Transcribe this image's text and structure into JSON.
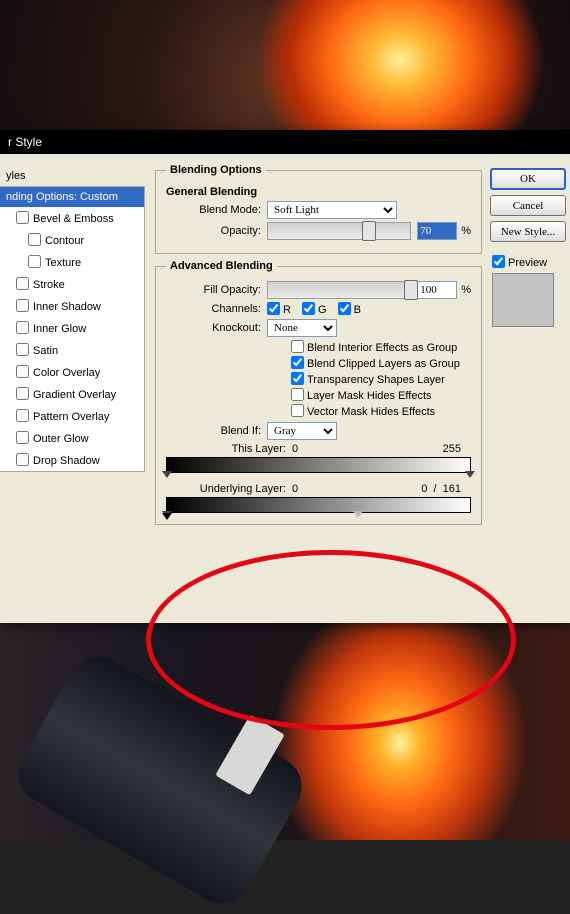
{
  "window": {
    "title": "r Style"
  },
  "sidebar": {
    "header": "yles",
    "items": [
      {
        "label": "nding Options: Custom",
        "selected": true
      },
      {
        "label": "Bevel & Emboss",
        "check": false
      },
      {
        "label": "Contour",
        "check": false,
        "indent": true
      },
      {
        "label": "Texture",
        "check": false,
        "indent": true
      },
      {
        "label": "Stroke",
        "check": false
      },
      {
        "label": "Inner Shadow",
        "check": false
      },
      {
        "label": "Inner Glow",
        "check": false
      },
      {
        "label": "Satin",
        "check": false
      },
      {
        "label": "Color Overlay",
        "check": false
      },
      {
        "label": "Gradient Overlay",
        "check": false
      },
      {
        "label": "Pattern Overlay",
        "check": false
      },
      {
        "label": "Outer Glow",
        "check": false
      },
      {
        "label": "Drop Shadow",
        "check": false
      }
    ]
  },
  "general": {
    "legend": "Blending Options",
    "heading": "General Blending",
    "blend_mode_label": "Blend Mode:",
    "blend_mode_value": "Soft Light",
    "opacity_label": "Opacity:",
    "opacity_value": "70",
    "pct": "%"
  },
  "advanced": {
    "heading": "Advanced Blending",
    "fill_opacity_label": "Fill Opacity:",
    "fill_opacity_value": "100",
    "pct": "%",
    "channels_label": "Channels:",
    "ch_r": "R",
    "ch_g": "G",
    "ch_b": "B",
    "knockout_label": "Knockout:",
    "knockout_value": "None",
    "cb1": "Blend Interior Effects as Group",
    "cb2": "Blend Clipped Layers as Group",
    "cb3": "Transparency Shapes Layer",
    "cb4": "Layer Mask Hides Effects",
    "cb5": "Vector Mask Hides Effects"
  },
  "blendif": {
    "label": "Blend If:",
    "value": "Gray",
    "this_layer_label": "This Layer:",
    "this_layer_lo": "0",
    "this_layer_hi": "255",
    "under_label": "Underlying Layer:",
    "under_lo": "0",
    "under_hi_a": "0",
    "under_hi_b": "161",
    "slash": "/"
  },
  "buttons": {
    "ok": "OK",
    "cancel": "Cancel",
    "new_style": "New Style...",
    "preview": "Preview"
  }
}
